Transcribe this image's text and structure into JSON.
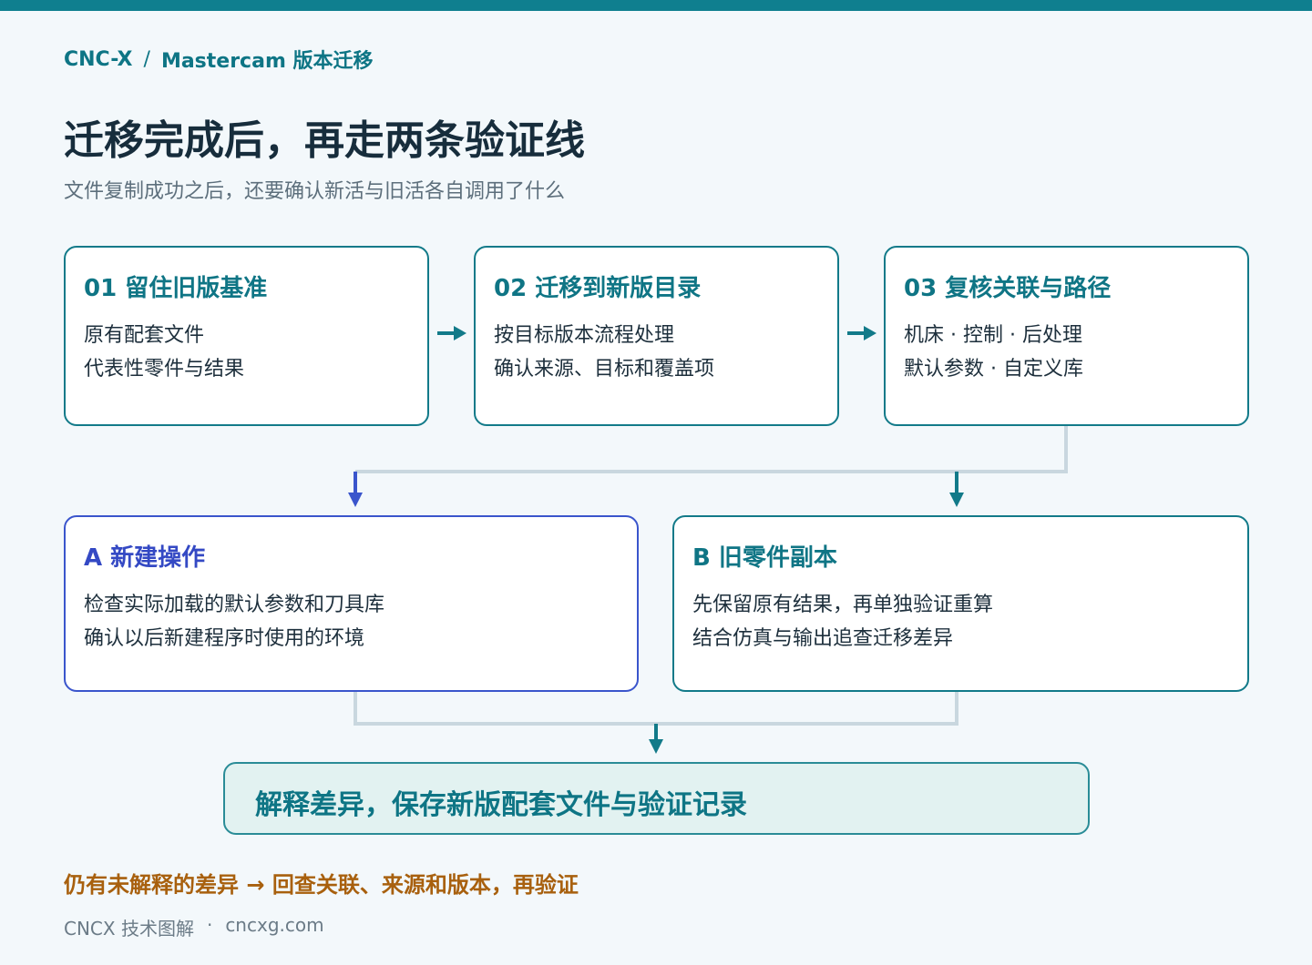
{
  "breadcrumb": {
    "root": "CNC-X",
    "separator": "/",
    "current": "Mastercam 版本迁移"
  },
  "title": "迁移完成后，再走两条验证线",
  "subtitle": "文件复制成功之后，还要确认新活与旧活各自调用了什么",
  "steps": [
    {
      "title": "01  留住旧版基准",
      "lines": [
        "原有配套文件",
        "代表性零件与结果"
      ]
    },
    {
      "title": "02  迁移到新版目录",
      "lines": [
        "按目标版本流程处理",
        "确认来源、目标和覆盖项"
      ]
    },
    {
      "title": "03  复核关联与路径",
      "lines": [
        "机床 · 控制 · 后处理",
        "默认参数 · 自定义库"
      ]
    }
  ],
  "branches": [
    {
      "title": "A  新建操作",
      "lines": [
        "检查实际加载的默认参数和刀具库",
        "确认以后新建程序时使用的环境"
      ]
    },
    {
      "title": "B  旧零件副本",
      "lines": [
        "先保留原有结果，再单独验证重算",
        "结合仿真与输出追查迁移差异"
      ]
    }
  ],
  "result": "解释差异，保存新版配套文件与验证记录",
  "note": "仍有未解释的差异 → 回查关联、来源和版本，再验证",
  "footer": {
    "brand": "CNCX 技术图解",
    "dot": "·",
    "site": "cncxg.com"
  },
  "colors": {
    "teal": "#0f7f8f",
    "blue": "#3a55cc",
    "orange": "#a8600e",
    "connector": "#c9d7df"
  }
}
